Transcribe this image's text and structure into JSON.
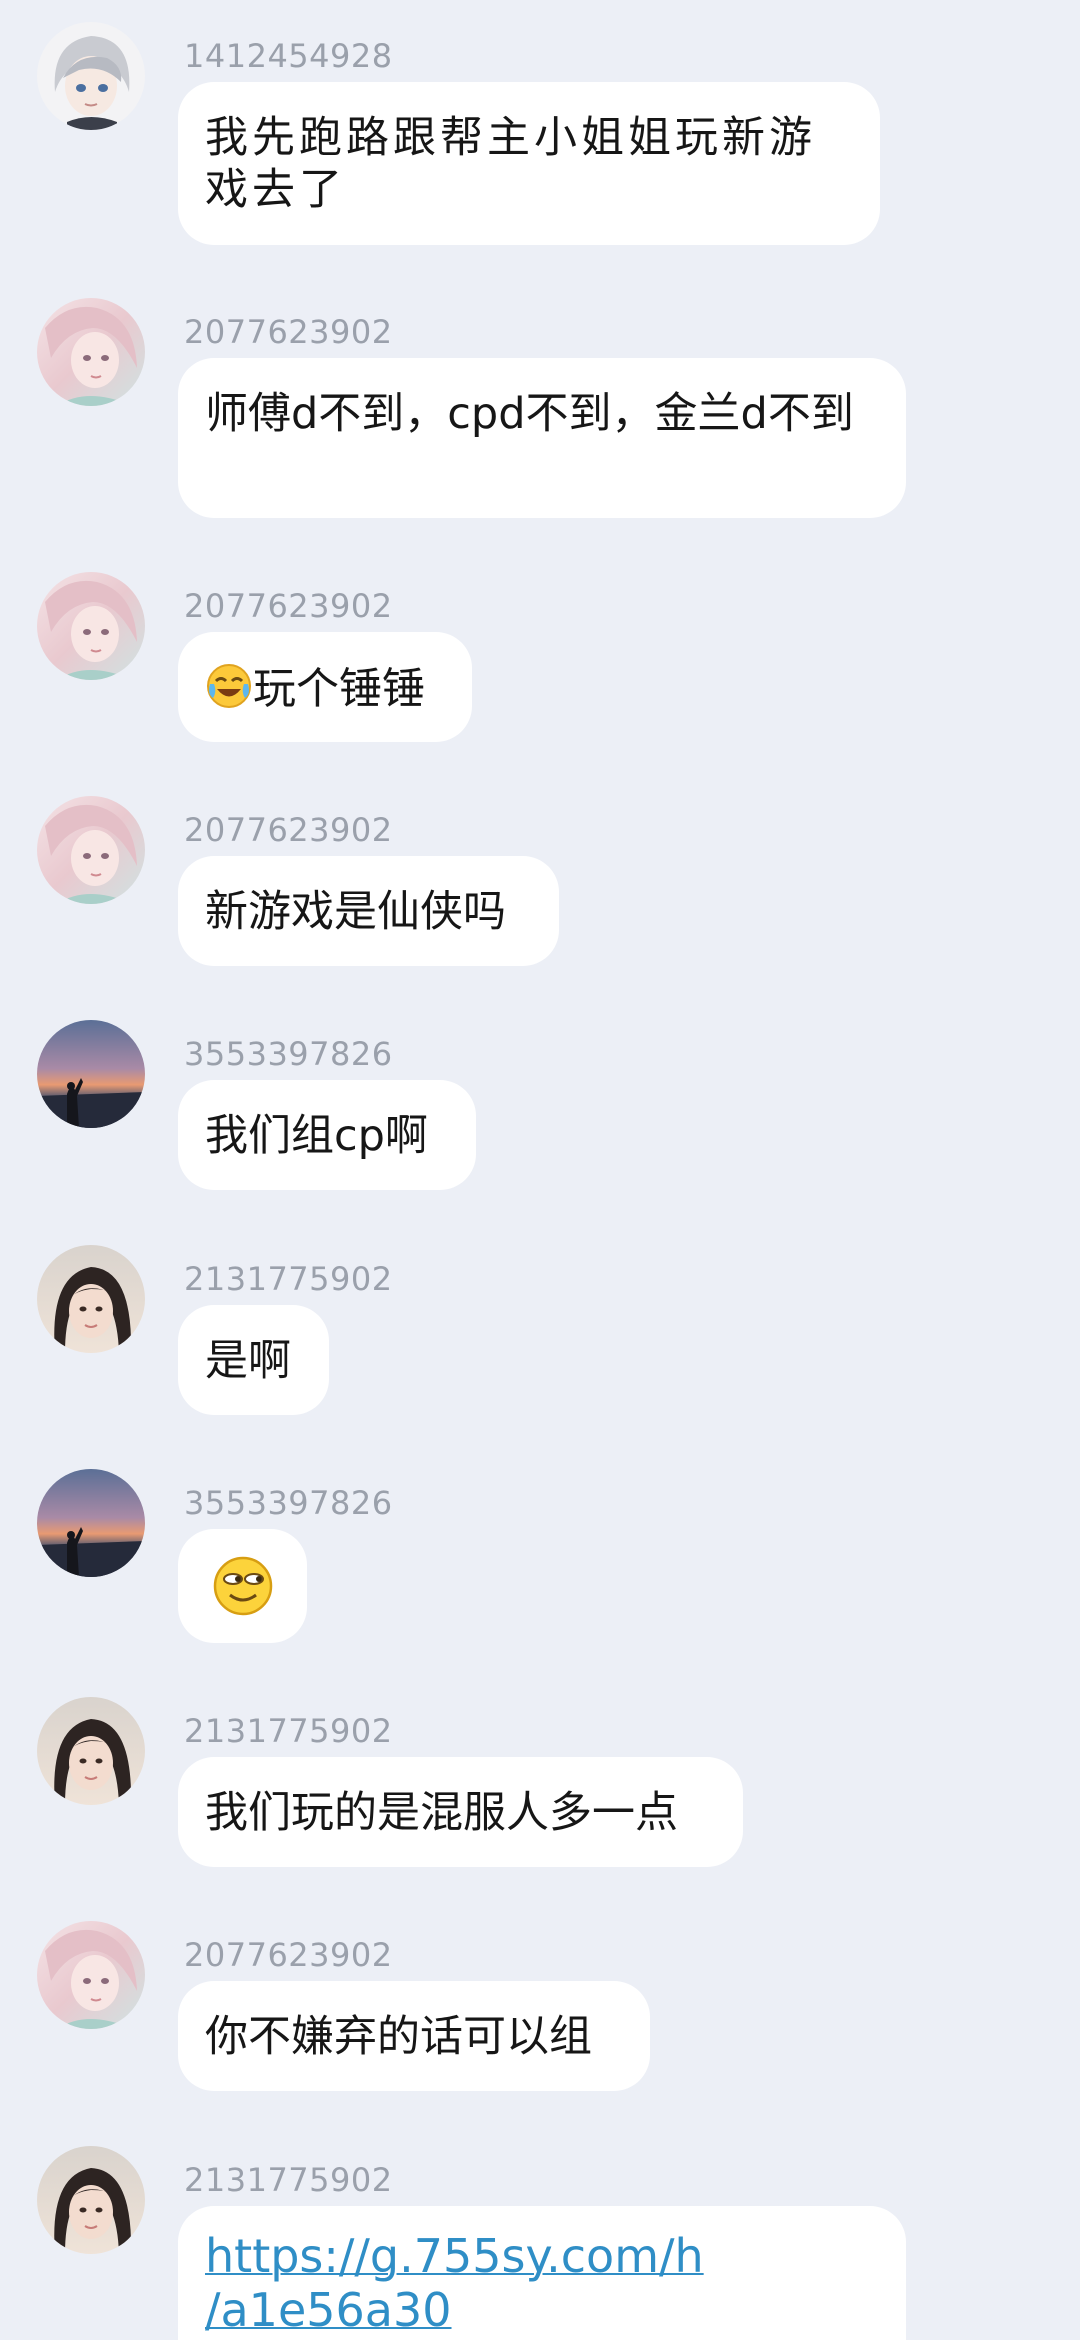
{
  "messages": [
    {
      "sender": "1412454928",
      "text": "我先跑路跟帮主小姐姐玩新游戏去了",
      "avatar": "silver-hair-anime-avatar"
    },
    {
      "sender": "2077623902",
      "text": "师傅d不到，cpd不到，金兰d不到",
      "avatar": "anime-girl-avatar"
    },
    {
      "sender": "2077623902",
      "emoji": "laughing-crying-emoji",
      "text": "玩个锤锤",
      "avatar": "anime-girl-avatar"
    },
    {
      "sender": "2077623902",
      "text": "新游戏是仙侠吗",
      "avatar": "anime-girl-avatar"
    },
    {
      "sender": "3553397826",
      "text": "我们组cp啊",
      "avatar": "sunset-silhouette-avatar"
    },
    {
      "sender": "2131775902",
      "text": "是啊",
      "avatar": "girl-photo-avatar"
    },
    {
      "sender": "3553397826",
      "emoji": "side-eye-smile-emoji",
      "avatar": "sunset-silhouette-avatar"
    },
    {
      "sender": "2131775902",
      "text": "我们玩的是混服人多一点",
      "avatar": "girl-photo-avatar"
    },
    {
      "sender": "2077623902",
      "text": "你不嫌弃的话可以组",
      "avatar": "anime-girl-avatar"
    },
    {
      "sender": "2131775902",
      "link": "https://g.755sy.com/h/a1e56a30",
      "link_line1": "https://g.755sy.com/h",
      "link_line2": "/a1e56a30",
      "avatar": "girl-photo-avatar"
    }
  ],
  "colors": {
    "background": "#eceff6",
    "bubble": "#ffffff",
    "sender_text": "#9aa0ab",
    "link": "#2f8ec6"
  }
}
